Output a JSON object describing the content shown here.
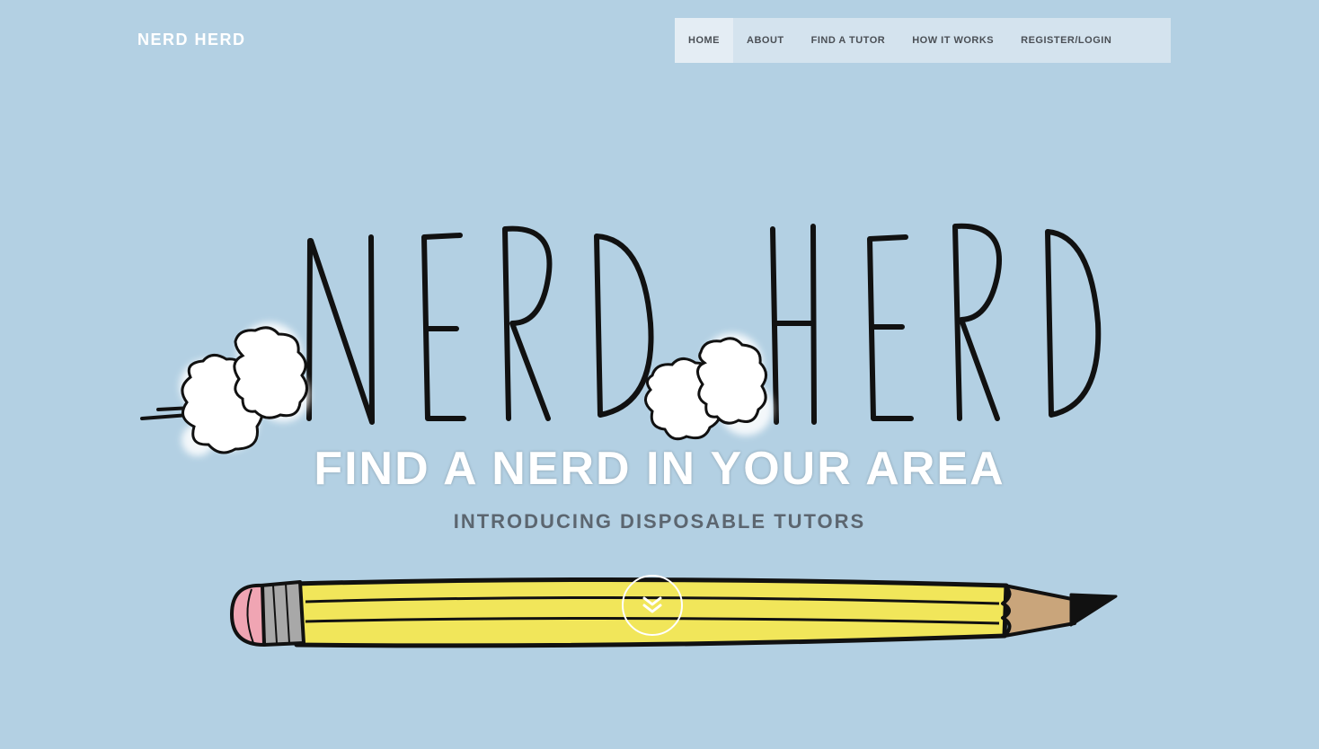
{
  "brand": {
    "name": "NERD HERD"
  },
  "nav": {
    "items": [
      {
        "label": "HOME",
        "active": true
      },
      {
        "label": "ABOUT"
      },
      {
        "label": "FIND A TUTOR"
      },
      {
        "label": "HOW IT WORKS"
      },
      {
        "label": "REGISTER/LOGIN"
      }
    ]
  },
  "hero": {
    "logo_text": "NERD HERD",
    "headline": "FIND A NERD IN YOUR AREA",
    "subheadline": "INTRODUCING DISPOSABLE TUTORS",
    "scroll_icon": "double-chevron-down-icon"
  },
  "colors": {
    "background": "#b3d0e3",
    "nav_background": "#d4e3ee",
    "headline": "#ffffff",
    "subheadline": "#5c6670",
    "pencil_body": "#f1e65a",
    "eraser": "#f0a5b3"
  }
}
